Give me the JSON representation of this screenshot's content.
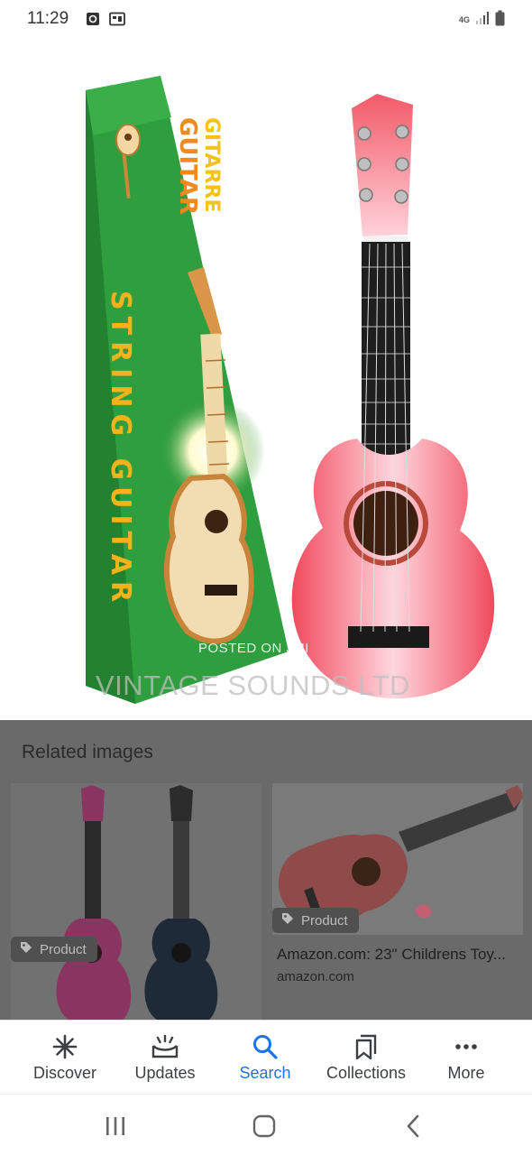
{
  "status_bar": {
    "time": "11:29",
    "network": "4G",
    "icons": [
      "notification-icon",
      "gallery-icon",
      "network-4g-icon",
      "signal-icon",
      "battery-icon"
    ]
  },
  "viewer": {
    "box_text_brand": "GUITAR",
    "box_text_brand2": "GITARRE",
    "box_text_side": "STRING GUITAR",
    "watermark_posted": "POSTED ON JIJI",
    "watermark_brand": "VINTAGE SOUNDS LTD"
  },
  "related": {
    "title": "Related images",
    "cards": [
      {
        "badge": "Product"
      },
      {
        "badge": "Product",
        "caption": "Amazon.com: 23\" Childrens Toy...",
        "source": "amazon.com"
      }
    ]
  },
  "bottom_nav": {
    "items": [
      {
        "label": "Discover",
        "icon": "asterisk-icon"
      },
      {
        "label": "Updates",
        "icon": "updates-icon"
      },
      {
        "label": "Search",
        "icon": "search-icon"
      },
      {
        "label": "Collections",
        "icon": "collections-icon"
      },
      {
        "label": "More",
        "icon": "more-icon"
      }
    ],
    "active": "Search",
    "active_color": "#1a73e8"
  },
  "system_nav": {
    "icons": [
      "recent-apps-icon",
      "home-icon",
      "back-icon"
    ]
  }
}
